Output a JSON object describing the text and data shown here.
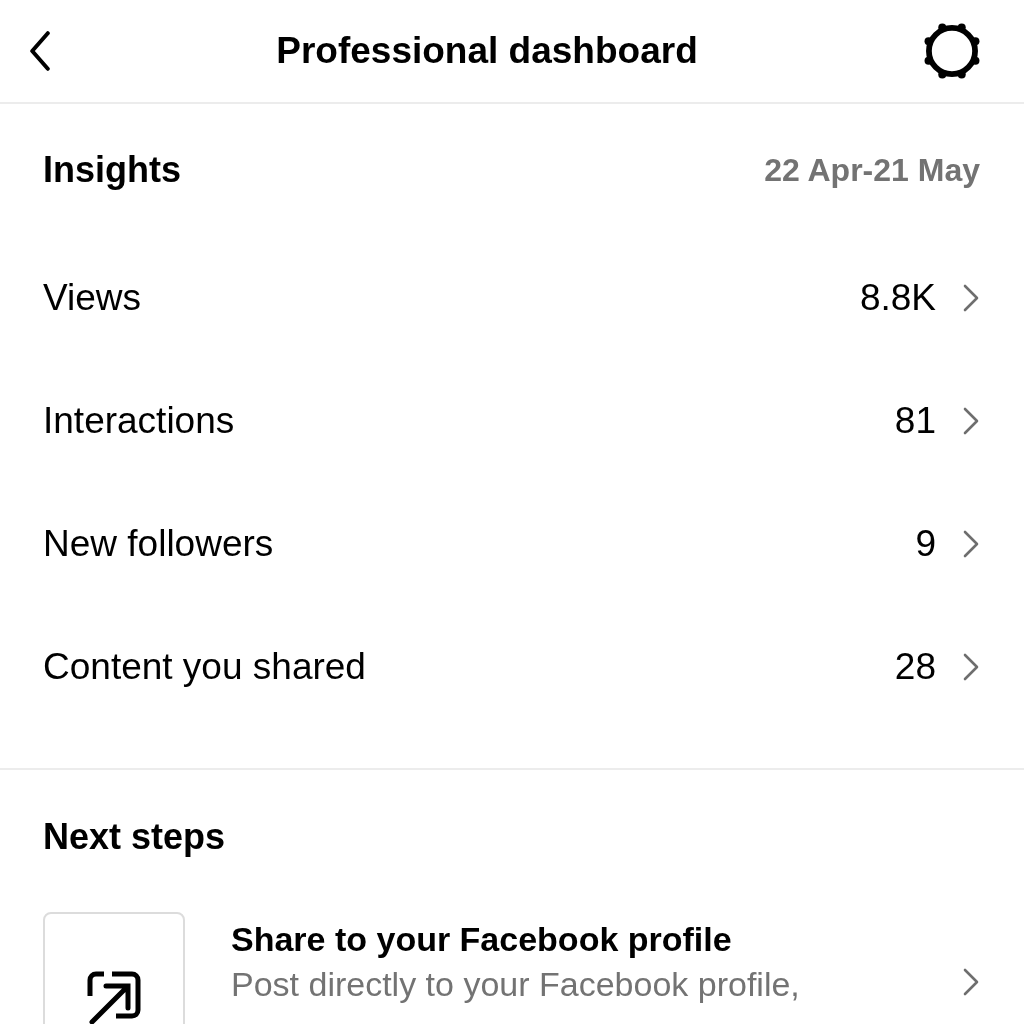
{
  "header": {
    "title": "Professional dashboard"
  },
  "insights": {
    "title": "Insights",
    "date_range": "22 Apr-21 May",
    "rows": [
      {
        "label": "Views",
        "value": "8.8K"
      },
      {
        "label": "Interactions",
        "value": "81"
      },
      {
        "label": "New followers",
        "value": "9"
      },
      {
        "label": "Content you shared",
        "value": "28"
      }
    ]
  },
  "next_steps": {
    "title": "Next steps",
    "items": [
      {
        "title": "Share to your Facebook profile",
        "description": "Post directly to your Facebook profile,"
      }
    ]
  }
}
